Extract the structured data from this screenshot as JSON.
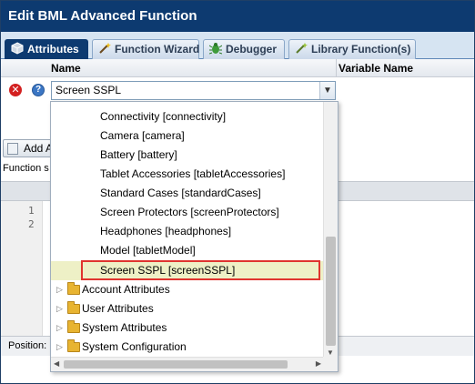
{
  "window": {
    "title": "Edit BML Advanced Function"
  },
  "tabs": [
    {
      "label": "Attributes",
      "active": true,
      "icon": "cube-icon"
    },
    {
      "label": "Function Wizard",
      "active": false,
      "icon": "wand-icon"
    },
    {
      "label": "Debugger",
      "active": false,
      "icon": "bug-icon"
    },
    {
      "label": "Library Function(s)",
      "active": false,
      "icon": "library-icon"
    }
  ],
  "columns": {
    "name": "Name",
    "variable_name": "Variable Name"
  },
  "name_field": {
    "value": "Screen SSPL"
  },
  "add_button": {
    "label": "Add A"
  },
  "function_label": "Function s",
  "line_numbers": [
    "1",
    "2"
  ],
  "position_label": "Position:",
  "dropdown": {
    "items": [
      {
        "label": "Connectivity [connectivity]",
        "type": "leaf"
      },
      {
        "label": "Camera [camera]",
        "type": "leaf"
      },
      {
        "label": "Battery [battery]",
        "type": "leaf"
      },
      {
        "label": "Tablet Accessories [tabletAccessories]",
        "type": "leaf"
      },
      {
        "label": "Standard Cases [standardCases]",
        "type": "leaf"
      },
      {
        "label": "Screen Protectors [screenProtectors]",
        "type": "leaf"
      },
      {
        "label": "Headphones [headphones]",
        "type": "leaf"
      },
      {
        "label": "Model [tabletModel]",
        "type": "leaf"
      },
      {
        "label": "Screen SSPL [screenSSPL]",
        "type": "leaf",
        "selected": true
      },
      {
        "label": "Account Attributes",
        "type": "folder"
      },
      {
        "label": "User Attributes",
        "type": "folder"
      },
      {
        "label": "System Attributes",
        "type": "folder"
      },
      {
        "label": "System Configuration",
        "type": "folder"
      }
    ]
  },
  "colors": {
    "title_bar": "#0d3a70",
    "selection_highlight": "#eef0c6",
    "selection_outline": "#e0342f",
    "folder": "#e8b431"
  }
}
